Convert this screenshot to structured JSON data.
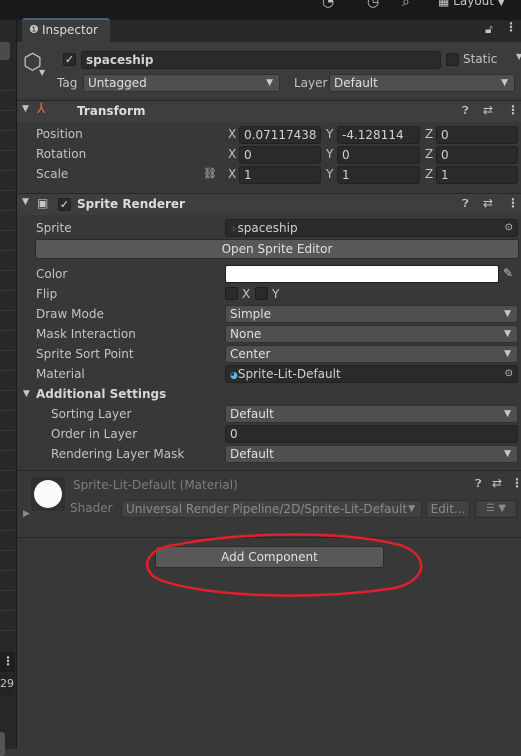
{
  "tab": {
    "label": "Inspector"
  },
  "topbar": {
    "layout_label": "Layout"
  },
  "left_strip": {
    "number": "29"
  },
  "object": {
    "name": "spaceship",
    "static_label": "Static",
    "tag_label": "Tag",
    "tag_value": "Untagged",
    "layer_label": "Layer",
    "layer_value": "Default"
  },
  "transform": {
    "title": "Transform",
    "rows": [
      {
        "label": "Position",
        "x": "0.07117438",
        "y": "-4.128114",
        "z": "0"
      },
      {
        "label": "Rotation",
        "x": "0",
        "y": "0",
        "z": "0"
      },
      {
        "label": "Scale",
        "x": "1",
        "y": "1",
        "z": "1"
      }
    ],
    "axes": {
      "x": "X",
      "y": "Y",
      "z": "Z"
    }
  },
  "sprite_renderer": {
    "title": "Sprite Renderer",
    "sprite_label": "Sprite",
    "sprite_value": "spaceship",
    "open_editor": "Open Sprite Editor",
    "color_label": "Color",
    "color_value": "#ffffff",
    "flip_label": "Flip",
    "flip_x": "X",
    "flip_y": "Y",
    "draw_mode_label": "Draw Mode",
    "draw_mode_value": "Simple",
    "mask_label": "Mask Interaction",
    "mask_value": "None",
    "sort_point_label": "Sprite Sort Point",
    "sort_point_value": "Center",
    "material_label": "Material",
    "material_value": "Sprite-Lit-Default",
    "additional_label": "Additional Settings",
    "sorting_layer_label": "Sorting Layer",
    "sorting_layer_value": "Default",
    "order_label": "Order in Layer",
    "order_value": "0",
    "rendering_mask_label": "Rendering Layer Mask",
    "rendering_mask_value": "Default"
  },
  "material": {
    "title": "Sprite-Lit-Default (Material)",
    "shader_label": "Shader",
    "shader_value": "Universal Render Pipeline/2D/Sprite-Lit-Default",
    "edit_label": "Edit..."
  },
  "add_component": {
    "label": "Add Component"
  },
  "colors": {
    "accent": "#46607c",
    "annotation": "#e0202a",
    "background": "#383838"
  }
}
